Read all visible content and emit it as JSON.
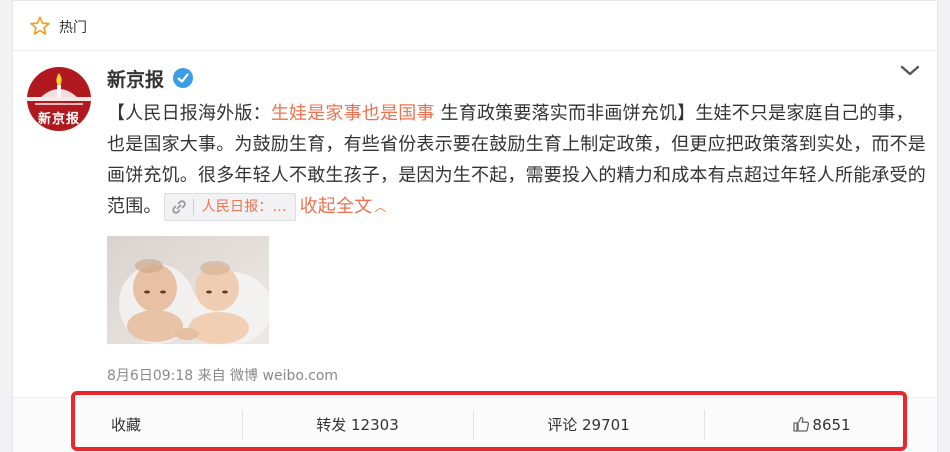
{
  "header": {
    "label": "热门",
    "icon": "star-outline-icon"
  },
  "post": {
    "account_name": "新京报",
    "avatar_text": "新京报",
    "verified_icon": "verified-badge-icon",
    "text": {
      "open_bracket": "【人民日报海外版：",
      "topic": "生娃是家事也是国事",
      "after_topic": " 生育政策要落实而非画饼充饥】生娃不只是家庭自己的事，也是国家大事。为鼓励生育，有些省份表示要在鼓励生育上制定政策，但更应把政策落到实处，而不是画饼充饥。很多年轻人不敢生孩子，是因为生不起，需要投入的精力和成本有点超过年轻人所能承受的范围。"
    },
    "link_card_label": "人民日报：...",
    "collapse_label": "收起全文",
    "meta": "8月6日09:18 来自 微博 weibo.com"
  },
  "actions": {
    "favorite": "收藏",
    "repost": "转发 12303",
    "comment": "评论 29701",
    "like": "8651"
  },
  "colors": {
    "accent": "#eb7350",
    "highlight": "#e8272c",
    "brand_red": "#b0191e",
    "verified_blue": "#3a9ee6"
  }
}
